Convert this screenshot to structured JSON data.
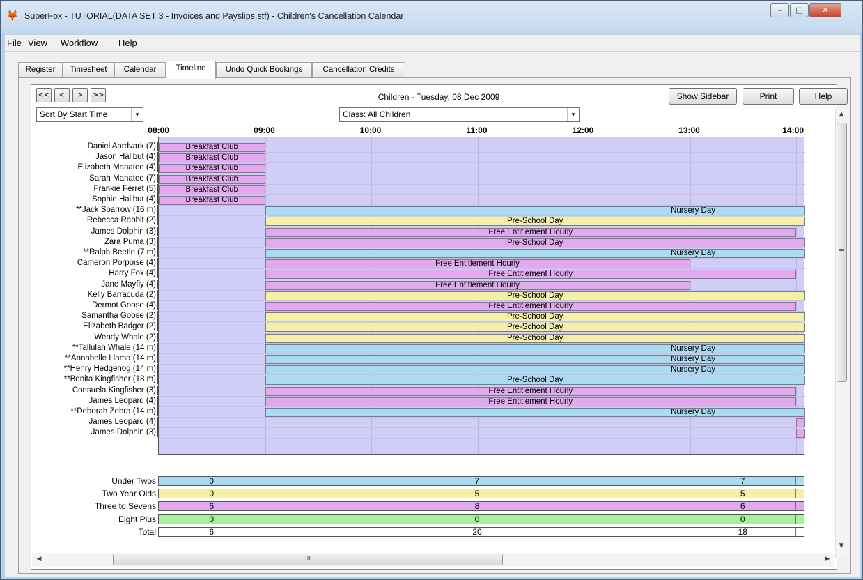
{
  "window": {
    "title": "SuperFox - TUTORIAL(DATA SET 3  -  Invoices and Payslips.stf) - Children's Cancellation Calendar",
    "app_icon": "fox-icon"
  },
  "menu": [
    "File",
    "View",
    "Workflow",
    "Help"
  ],
  "tabs": [
    {
      "label": "Register",
      "active": false
    },
    {
      "label": "Timesheet",
      "active": false
    },
    {
      "label": "Calendar",
      "active": false
    },
    {
      "label": "Timeline",
      "active": true
    },
    {
      "label": "Undo Quick Bookings",
      "active": false
    },
    {
      "label": "Cancellation Credits",
      "active": false
    }
  ],
  "nav": {
    "first": "<<",
    "prev": "<",
    "next": ">",
    "last": ">>"
  },
  "header": {
    "title": "Children - Tuesday, 08 Dec 2009",
    "show_sidebar": "Show Sidebar",
    "print": "Print",
    "help": "Help",
    "sort_select": "Sort By Start Time",
    "class_select": "Class: All Children"
  },
  "hours": [
    "08:00",
    "09:00",
    "10:00",
    "11:00",
    "12:00",
    "13:00",
    "14:00"
  ],
  "colors": {
    "background": "#d0cdf6",
    "breakfast": "#e6a6f0",
    "nursery": "#a9dcf0",
    "preschool": "#f5f0a6",
    "entitlement": "#e3a9ef",
    "under_twos": "#a9dcf0",
    "two_year_olds": "#f5f0a6",
    "three_to_sevens": "#e3a9ef",
    "eight_plus": "#a8f0a0",
    "total": "#ffffff"
  },
  "children": [
    {
      "name": "Daniel Aardvark (7)",
      "booking": "Breakfast Club",
      "kind": "breakfast",
      "start": "08:00",
      "end": "09:00"
    },
    {
      "name": "Jason Halibut (4)",
      "booking": "Breakfast Club",
      "kind": "breakfast",
      "start": "08:00",
      "end": "09:00"
    },
    {
      "name": "Elizabeth Manatee (4)",
      "booking": "Breakfast Club",
      "kind": "breakfast",
      "start": "08:00",
      "end": "09:00"
    },
    {
      "name": "Sarah Manatee (7)",
      "booking": "Breakfast Club",
      "kind": "breakfast",
      "start": "08:00",
      "end": "09:00"
    },
    {
      "name": "Frankie Ferret (5)",
      "booking": "Breakfast Club",
      "kind": "breakfast",
      "start": "08:00",
      "end": "09:00"
    },
    {
      "name": "Sophie Halibut (4)",
      "booking": "Breakfast Club",
      "kind": "breakfast",
      "start": "08:00",
      "end": "09:00"
    },
    {
      "name": "**Jack Sparrow (16 m)",
      "booking": "Nursery Day",
      "kind": "nursery",
      "start": "09:00",
      "end": "14:00+"
    },
    {
      "name": "Rebecca Rabbit (2)",
      "booking": "Pre-School Day",
      "kind": "preschool",
      "start": "09:00",
      "end": "14:00+"
    },
    {
      "name": "James Dolphin (3)",
      "booking": "Free Entitlement Hourly",
      "kind": "entitlement",
      "start": "09:00",
      "end": "14:00"
    },
    {
      "name": "Zara Puma (3)",
      "booking": "Pre-School Day",
      "kind": "entitlement",
      "start": "09:00",
      "end": "14:00+"
    },
    {
      "name": "**Ralph Beetle (7 m)",
      "booking": "Nursery Day",
      "kind": "nursery",
      "start": "09:00",
      "end": "14:00+"
    },
    {
      "name": "Cameron Porpoise (4)",
      "booking": "Free Entitlement Hourly",
      "kind": "entitlement",
      "start": "09:00",
      "end": "13:00"
    },
    {
      "name": "Harry Fox (4)",
      "booking": "Free Entitlement Hourly",
      "kind": "entitlement",
      "start": "09:00",
      "end": "14:00"
    },
    {
      "name": "Jane Mayfly (4)",
      "booking": "Free Entitlement Hourly",
      "kind": "entitlement",
      "start": "09:00",
      "end": "13:00"
    },
    {
      "name": "Kelly Barracuda (2)",
      "booking": "Pre-School Day",
      "kind": "preschool",
      "start": "09:00",
      "end": "14:00+"
    },
    {
      "name": "Dermot Goose (4)",
      "booking": "Free Entitlement Hourly",
      "kind": "entitlement",
      "start": "09:00",
      "end": "14:00"
    },
    {
      "name": "Samantha Goose (2)",
      "booking": "Pre-School Day",
      "kind": "preschool",
      "start": "09:00",
      "end": "14:00+"
    },
    {
      "name": "Elizabeth Badger (2)",
      "booking": "Pre-School Day",
      "kind": "preschool",
      "start": "09:00",
      "end": "14:00+"
    },
    {
      "name": "Wendy Whale (2)",
      "booking": "Pre-School Day",
      "kind": "preschool",
      "start": "09:00",
      "end": "14:00+"
    },
    {
      "name": "**Tallulah Whale (14 m)",
      "booking": "Nursery Day",
      "kind": "nursery",
      "start": "09:00",
      "end": "14:00+"
    },
    {
      "name": "**Annabelle Llama (14 m)",
      "booking": "Nursery Day",
      "kind": "nursery",
      "start": "09:00",
      "end": "14:00+"
    },
    {
      "name": "**Henry Hedgehog (14 m)",
      "booking": "Nursery Day",
      "kind": "nursery",
      "start": "09:00",
      "end": "14:00+"
    },
    {
      "name": "**Bonita Kingfisher (18 m)",
      "booking": "Pre-School Day",
      "kind": "nursery",
      "start": "09:00",
      "end": "14:00+"
    },
    {
      "name": "Consuela Kingfisher (3)",
      "booking": "Free Entitlement Hourly",
      "kind": "entitlement",
      "start": "09:00",
      "end": "14:00"
    },
    {
      "name": "James Leopard (4)",
      "booking": "Free Entitlement Hourly",
      "kind": "entitlement",
      "start": "09:00",
      "end": "14:00"
    },
    {
      "name": "**Deborah Zebra (14 m)",
      "booking": "Nursery Day",
      "kind": "nursery",
      "start": "09:00",
      "end": "14:00+"
    },
    {
      "name": "James Leopard (4)",
      "booking": "",
      "kind": "entitlement",
      "start": "14:00",
      "end": "14:00+"
    },
    {
      "name": "James Dolphin (3)",
      "booking": "",
      "kind": "entitlement",
      "start": "14:00",
      "end": "14:00+"
    }
  ],
  "summary": [
    {
      "label": "Under Twos",
      "kind": "under_twos",
      "values": [
        "0",
        "7",
        "7"
      ]
    },
    {
      "label": "Two Year Olds",
      "kind": "two_year_olds",
      "values": [
        "0",
        "5",
        "5"
      ]
    },
    {
      "label": "Three to Sevens",
      "kind": "three_to_sevens",
      "values": [
        "6",
        "8",
        "6"
      ]
    },
    {
      "label": "Eight Plus",
      "kind": "eight_plus",
      "values": [
        "0",
        "0",
        "0"
      ]
    },
    {
      "label": "Total",
      "kind": "total",
      "values": [
        "6",
        "20",
        "18"
      ]
    }
  ],
  "scrollbar": {
    "grip": "III",
    "grip_v": "≡"
  }
}
